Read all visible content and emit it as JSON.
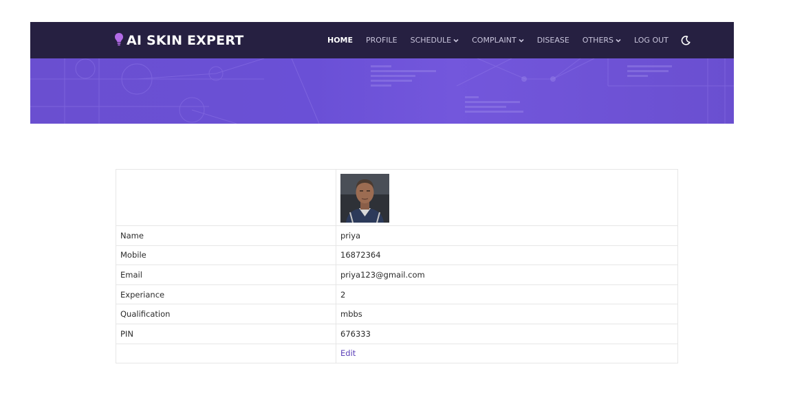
{
  "brand": {
    "name": "AI SKIN EXPERT",
    "icon": "lightbulb-icon",
    "icon_color": "#b26be6"
  },
  "nav": {
    "items": [
      {
        "label": "HOME",
        "active": true,
        "dropdown": false
      },
      {
        "label": "PROFILE",
        "active": false,
        "dropdown": false
      },
      {
        "label": "SCHEDULE",
        "active": false,
        "dropdown": true
      },
      {
        "label": "COMPLAINT",
        "active": false,
        "dropdown": true
      },
      {
        "label": "DISEASE",
        "active": false,
        "dropdown": false
      },
      {
        "label": "OTHERS",
        "active": false,
        "dropdown": true
      },
      {
        "label": "LOG OUT",
        "active": false,
        "dropdown": false
      }
    ],
    "theme_toggle_icon": "moon-icon"
  },
  "profile": {
    "photo_icon": "doctor-avatar",
    "rows": [
      {
        "label": "Name",
        "value": "priya"
      },
      {
        "label": "Mobile",
        "value": "16872364"
      },
      {
        "label": "Email",
        "value": "priya123@gmail.com"
      },
      {
        "label": "Experiance",
        "value": "2"
      },
      {
        "label": "Qualification",
        "value": "mbbs"
      },
      {
        "label": "PIN",
        "value": "676333"
      }
    ],
    "edit_label": "Edit"
  },
  "colors": {
    "header_bg": "#262041",
    "banner": "#6a4fd0",
    "link": "#5b3fb8"
  }
}
